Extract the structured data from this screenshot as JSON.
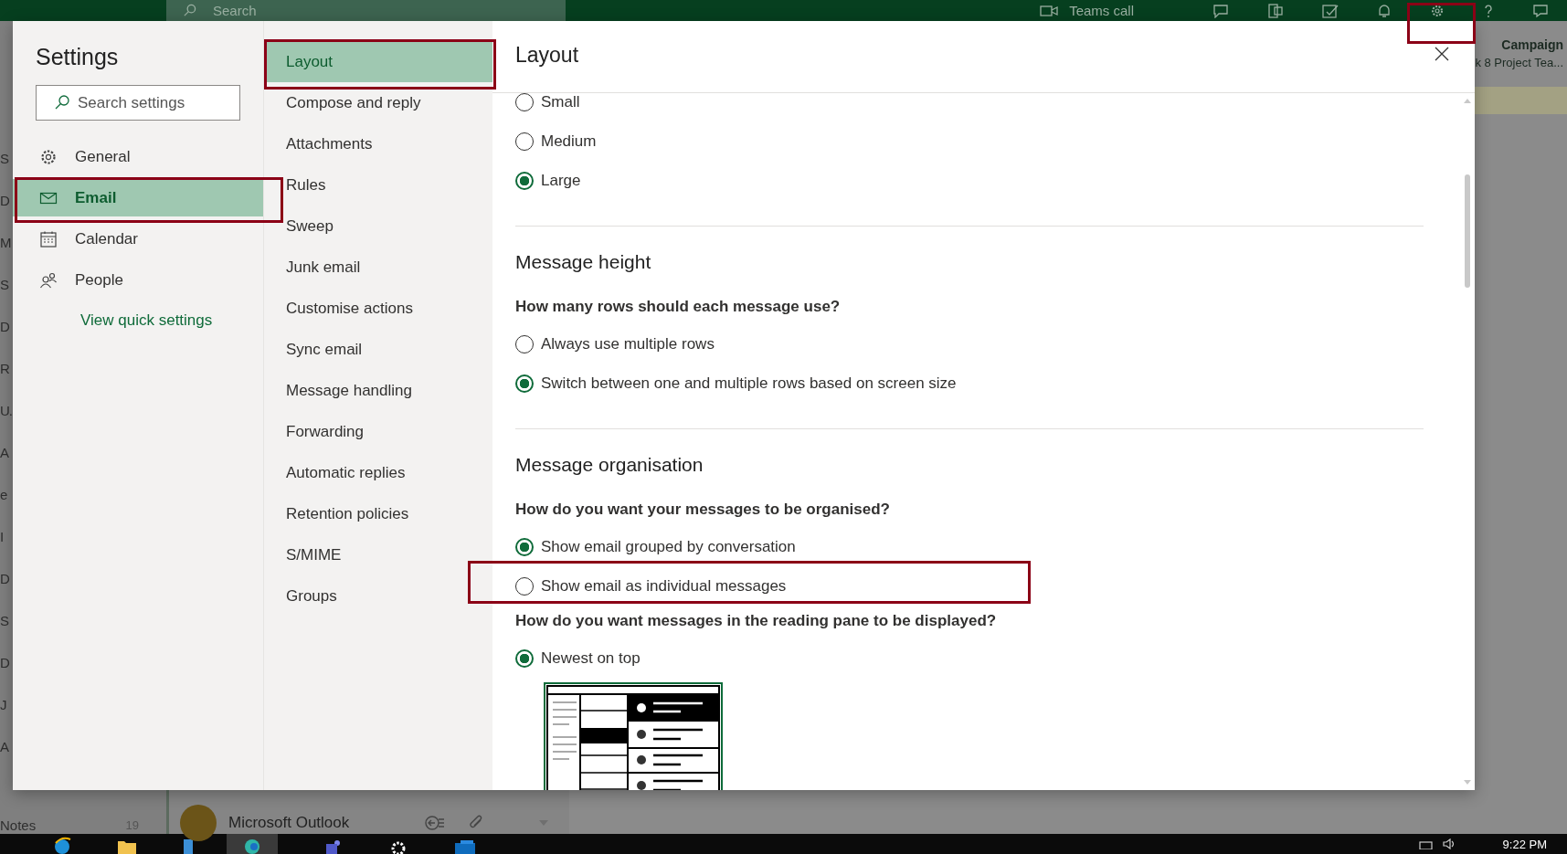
{
  "background": {
    "top_bar": {
      "search_placeholder": "Search",
      "teams_call": "Teams call"
    },
    "folder_fragments": [
      "S",
      "D",
      "M",
      "S",
      "D",
      "R",
      "U.",
      "A",
      "e",
      "I",
      "D",
      "S",
      "D",
      "J",
      "A"
    ],
    "folder_bottom": {
      "label": "Notes",
      "count": "19"
    },
    "message_sender": "Microsoft Outlook",
    "reading_pane_lines": [
      "Campaign",
      "k 8 Project Tea..."
    ]
  },
  "settings": {
    "title": "Settings",
    "search": {
      "placeholder": "Search settings"
    },
    "categories": [
      {
        "kind": "general",
        "label": "General",
        "selected": false
      },
      {
        "kind": "email",
        "label": "Email",
        "selected": true
      },
      {
        "kind": "calendar",
        "label": "Calendar",
        "selected": false
      },
      {
        "kind": "people",
        "label": "People",
        "selected": false
      }
    ],
    "quick_settings_link": "View quick settings",
    "subcategories": [
      {
        "label": "Layout",
        "selected": true
      },
      {
        "label": "Compose and reply",
        "selected": false
      },
      {
        "label": "Attachments",
        "selected": false
      },
      {
        "label": "Rules",
        "selected": false
      },
      {
        "label": "Sweep",
        "selected": false
      },
      {
        "label": "Junk email",
        "selected": false
      },
      {
        "label": "Customise actions",
        "selected": false
      },
      {
        "label": "Sync email",
        "selected": false
      },
      {
        "label": "Message handling",
        "selected": false
      },
      {
        "label": "Forwarding",
        "selected": false
      },
      {
        "label": "Automatic replies",
        "selected": false
      },
      {
        "label": "Retention policies",
        "selected": false
      },
      {
        "label": "S/MIME",
        "selected": false
      },
      {
        "label": "Groups",
        "selected": false
      }
    ]
  },
  "content": {
    "title": "Layout",
    "sections": [
      {
        "groups": [
          {
            "options": [
              {
                "label": "Small",
                "selected": false
              },
              {
                "label": "Medium",
                "selected": false
              },
              {
                "label": "Large",
                "selected": true
              }
            ]
          }
        ]
      },
      {
        "heading": "Message height",
        "groups": [
          {
            "question": "How many rows should each message use?",
            "options": [
              {
                "label": "Always use multiple rows",
                "selected": false
              },
              {
                "label": "Switch between one and multiple rows based on screen size",
                "selected": true
              }
            ]
          }
        ]
      },
      {
        "heading": "Message organisation",
        "groups": [
          {
            "question": "How do you want your messages to be organised?",
            "options": [
              {
                "label": "Show email grouped by conversation",
                "selected": true
              },
              {
                "label": "Show email as individual messages",
                "selected": false
              }
            ]
          },
          {
            "question": "How do you want messages in the reading pane to be displayed?",
            "options": [
              {
                "label": "Newest on top",
                "selected": true
              }
            ],
            "preview": true
          }
        ]
      }
    ]
  },
  "taskbar": {
    "time": "9:22 PM"
  }
}
